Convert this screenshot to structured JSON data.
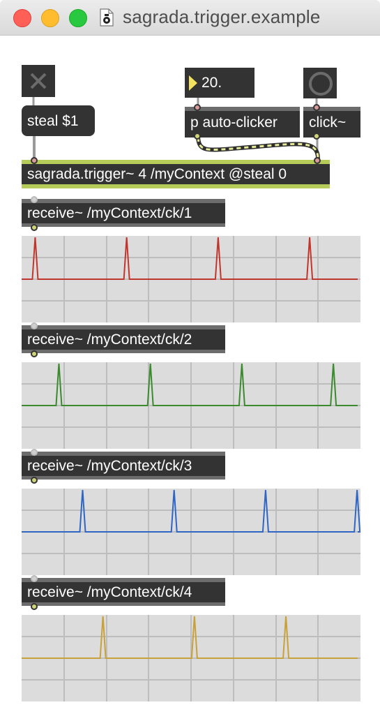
{
  "window": {
    "title": "sagrada.trigger.example"
  },
  "objects": {
    "toggle_icon": "x-toggle-icon",
    "steal_message": "steal $1",
    "number_value": "20.",
    "auto_clicker": "p auto-clicker",
    "click": "click~",
    "trigger": "sagrada.trigger~ 4 /myContext @steal 0"
  },
  "receivers": [
    {
      "label": "receive~ /myContext/ck/1",
      "color": "#c0362c",
      "peaks": [
        0.04,
        0.31,
        0.58,
        0.85
      ]
    },
    {
      "label": "receive~ /myContext/ck/2",
      "color": "#3b8a2e",
      "peaks": [
        0.11,
        0.38,
        0.65,
        0.92
      ]
    },
    {
      "label": "receive~ /myContext/ck/3",
      "color": "#2f66c4",
      "peaks": [
        0.18,
        0.45,
        0.72,
        0.99
      ]
    },
    {
      "label": "receive~ /myContext/ck/4",
      "color": "#c9a13a",
      "peaks": [
        0.24,
        0.51,
        0.78
      ]
    }
  ],
  "colors": {
    "object_bg": "#333333",
    "trigger_accent": "#b5cc5a",
    "scope_bg": "#dcdcdc",
    "grid": "#bdbdbd"
  }
}
